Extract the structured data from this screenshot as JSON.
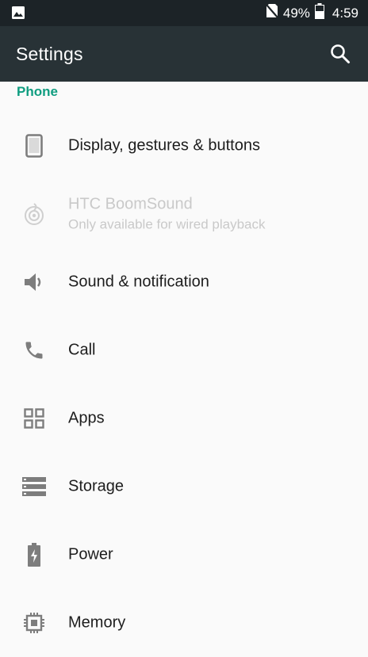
{
  "status_bar": {
    "left_icon": "image-icon",
    "signal_icon": "no-sim-icon",
    "battery_percent": "49%",
    "battery_icon": "battery-icon",
    "time": "4:59"
  },
  "app_bar": {
    "title": "Settings",
    "search_icon": "search-icon"
  },
  "section": {
    "label": "Phone",
    "color": "#0f9d80"
  },
  "items": [
    {
      "label": "Display, gestures & buttons",
      "icon": "phone-display-icon",
      "enabled": true
    },
    {
      "label": "HTC BoomSound",
      "sub": "Only available for wired playback",
      "icon": "boomsound-icon",
      "enabled": false
    },
    {
      "label": "Sound & notification",
      "icon": "speaker-icon",
      "enabled": true
    },
    {
      "label": "Call",
      "icon": "phone-icon",
      "enabled": true
    },
    {
      "label": "Apps",
      "icon": "apps-grid-icon",
      "enabled": true
    },
    {
      "label": "Storage",
      "icon": "storage-icon",
      "enabled": true
    },
    {
      "label": "Power",
      "icon": "battery-power-icon",
      "enabled": true
    },
    {
      "label": "Memory",
      "icon": "memory-chip-icon",
      "enabled": true
    }
  ]
}
